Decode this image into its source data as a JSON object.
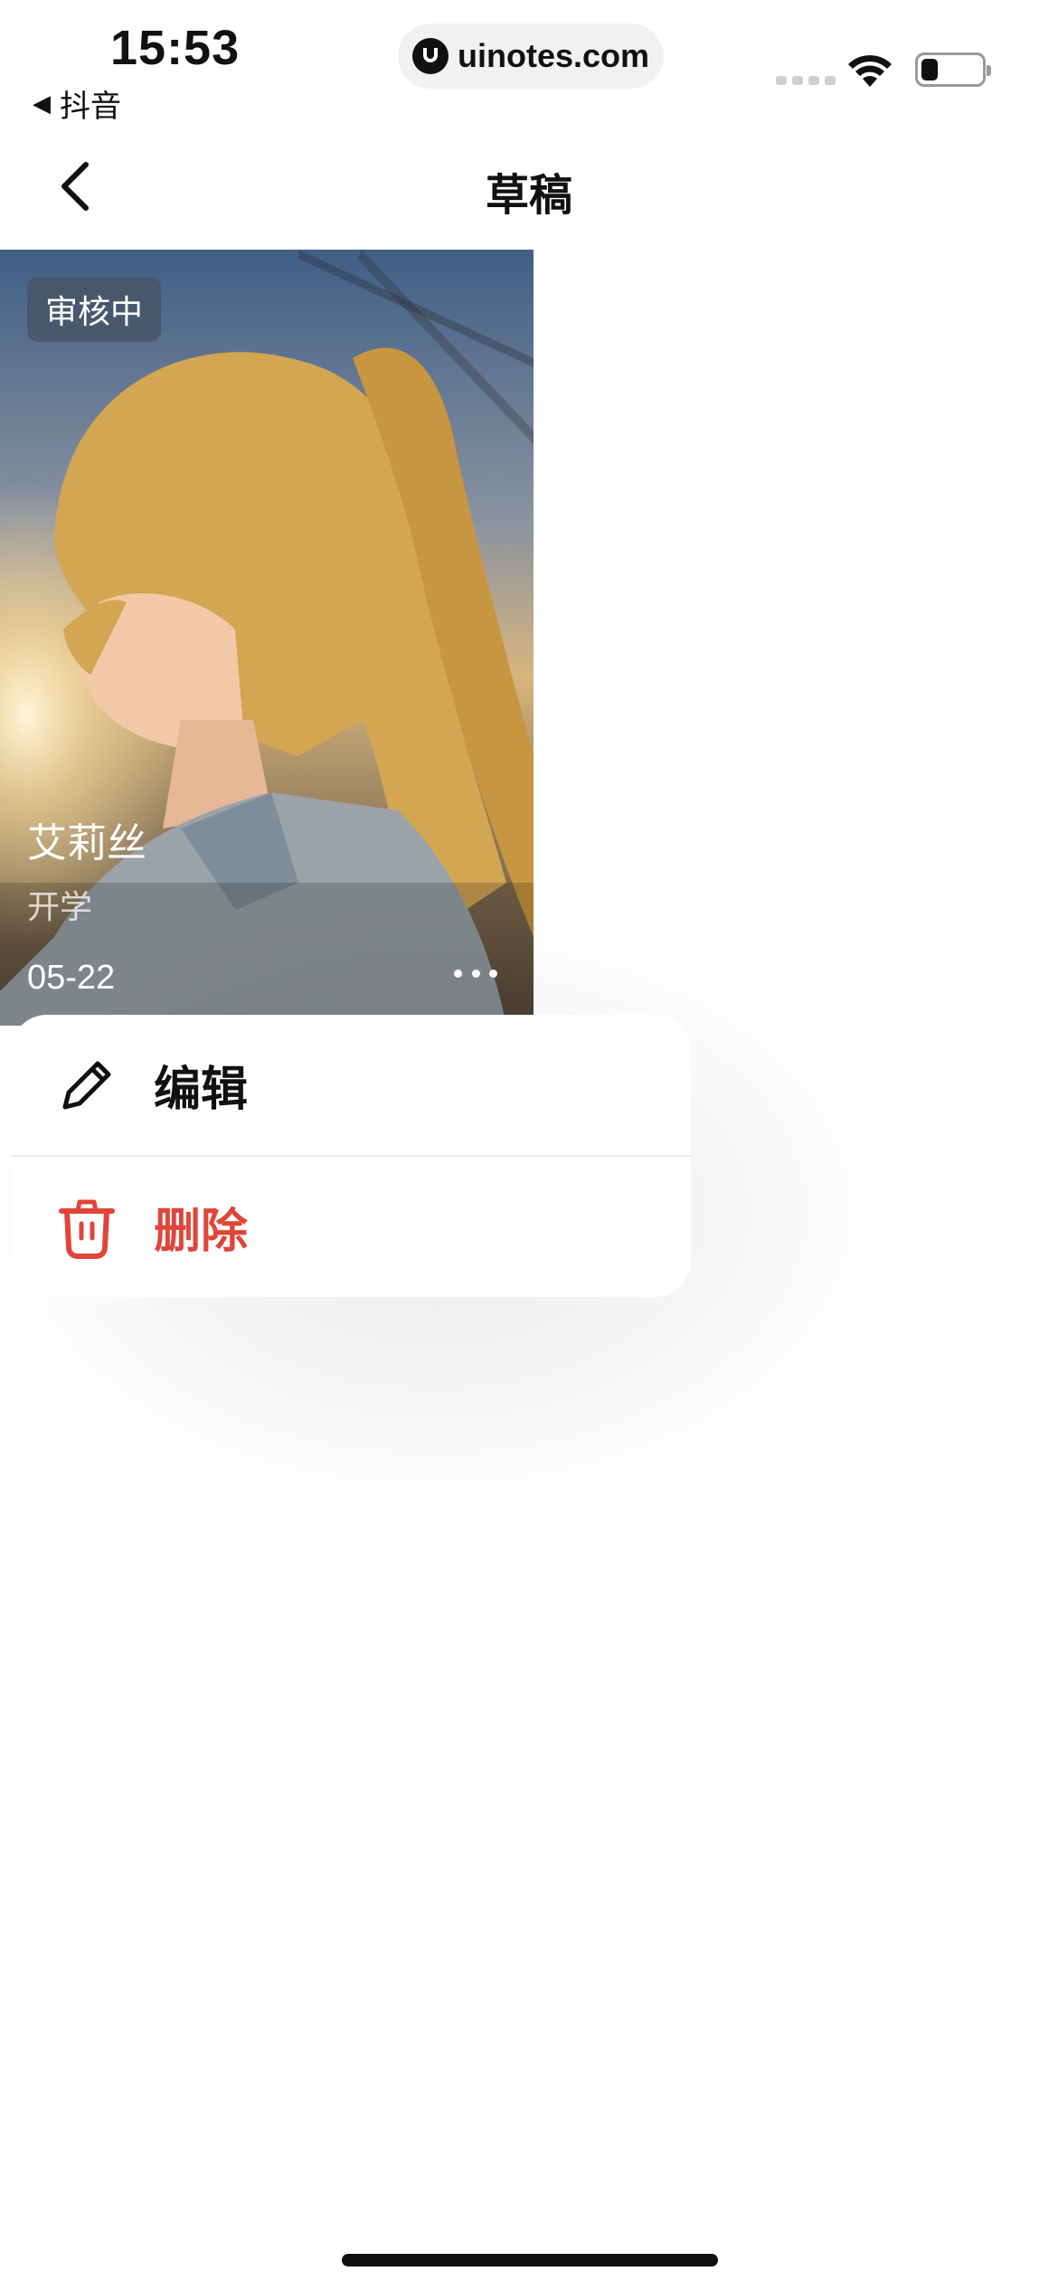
{
  "status_bar": {
    "time": "15:53",
    "back_app": "抖音",
    "url": "uinotes.com"
  },
  "header": {
    "title": "草稿"
  },
  "draft_card": {
    "status_badge": "审核中",
    "title": "艾莉丝",
    "subtitle": "开学",
    "date": "05-22"
  },
  "action_menu": {
    "edit_label": "编辑",
    "delete_label": "删除",
    "delete_color": "#e0453a"
  }
}
